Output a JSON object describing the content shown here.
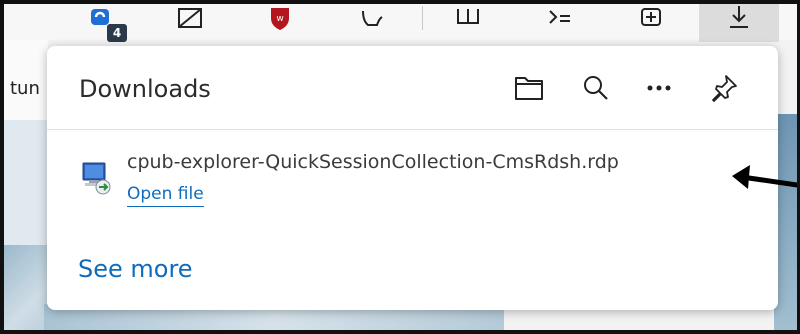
{
  "toolbar": {
    "icons": [
      "extension-badge-icon",
      "screenshot-icon",
      "shield-extension-icon",
      "puzzle-icon",
      "split-screen-icon",
      "favorites-icon",
      "collections-icon",
      "downloads-icon"
    ],
    "badge_count": "4"
  },
  "page": {
    "cut_text": "tun"
  },
  "downloads": {
    "title": "Downloads",
    "header_icons": [
      "folder-icon",
      "search-icon",
      "more-icon",
      "pin-icon"
    ],
    "item": {
      "filename": "cpub-explorer-QuickSessionCollection-CmsRdsh.rdp",
      "open_label": "Open file"
    },
    "see_more": "See more"
  },
  "colors": {
    "link": "#0f6cbd",
    "title": "#2b2b2b",
    "text": "#3b3b3b",
    "active_tab": "#dcdcdc"
  }
}
